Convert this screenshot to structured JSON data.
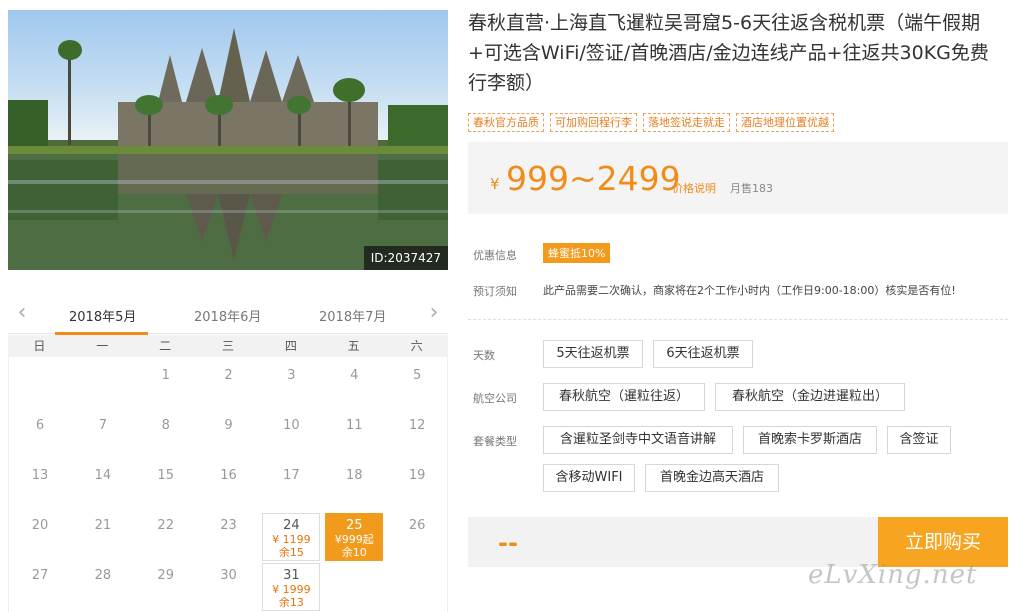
{
  "hero": {
    "image_id": "ID:2037427"
  },
  "product": {
    "title": "春秋直营·上海直飞暹粒吴哥窟5-6天往返含税机票（端午假期+可选含WiFi/签证/首晚酒店/金边连线产品+往返共30KG免费行李额）",
    "tags": [
      "春秋官方品质",
      "可加购回程行李",
      "落地签说走就走",
      "酒店地理位置优越"
    ]
  },
  "price": {
    "currency": "¥",
    "range": "999~2499",
    "help_label": "价格说明",
    "monthly_sales": "月售183"
  },
  "info": {
    "promo_label": "优惠信息",
    "promo_badge": "蜂蜜抵10%",
    "notice_label": "预订须知",
    "notice_text": "此产品需要二次确认，商家将在2个工作小时内（工作日9:00-18:00）核实是否有位!"
  },
  "options": {
    "days_label": "天数",
    "days": [
      "5天往返机票",
      "6天往返机票"
    ],
    "airline_label": "航空公司",
    "airlines": [
      "春秋航空（暹粒往返）",
      "春秋航空（金边进暹粒出）"
    ],
    "package_label": "套餐类型",
    "packages": [
      "含暹粒圣剑寺中文语音讲解",
      "首晚索卡罗斯酒店",
      "含签证",
      "含移动WIFI",
      "首晚金边高天酒店"
    ]
  },
  "buy": {
    "dash": "--",
    "button": "立即购买"
  },
  "calendar": {
    "prev_icon": "chevron-left-icon",
    "next_icon": "chevron-right-icon",
    "months": [
      "2018年5月",
      "2018年6月",
      "2018年7月"
    ],
    "weekdays": [
      "日",
      "一",
      "二",
      "三",
      "四",
      "五",
      "六"
    ],
    "days": [
      {
        "day": "1"
      },
      {
        "day": "2"
      },
      {
        "day": "3"
      },
      {
        "day": "4"
      },
      {
        "day": "5"
      },
      {
        "day": "6"
      },
      {
        "day": "7"
      },
      {
        "day": "8"
      },
      {
        "day": "9"
      },
      {
        "day": "10"
      },
      {
        "day": "11"
      },
      {
        "day": "12"
      },
      {
        "day": "13"
      },
      {
        "day": "14"
      },
      {
        "day": "15"
      },
      {
        "day": "16"
      },
      {
        "day": "17"
      },
      {
        "day": "18"
      },
      {
        "day": "19"
      },
      {
        "day": "20"
      },
      {
        "day": "21"
      },
      {
        "day": "22"
      },
      {
        "day": "23"
      },
      {
        "day": "24",
        "price": "¥ 1199",
        "stock": "余15"
      },
      {
        "day": "25",
        "price": "¥999起",
        "stock": "余10",
        "selected": true
      },
      {
        "day": "26"
      },
      {
        "day": "27"
      },
      {
        "day": "28"
      },
      {
        "day": "29"
      },
      {
        "day": "30"
      },
      {
        "day": "31",
        "price": "¥ 1999",
        "stock": "余13"
      }
    ]
  },
  "watermark": "eLvXing.net",
  "colors": {
    "accent": "#f08c1a",
    "button": "#f7a521",
    "tag_border": "#f0a050"
  }
}
